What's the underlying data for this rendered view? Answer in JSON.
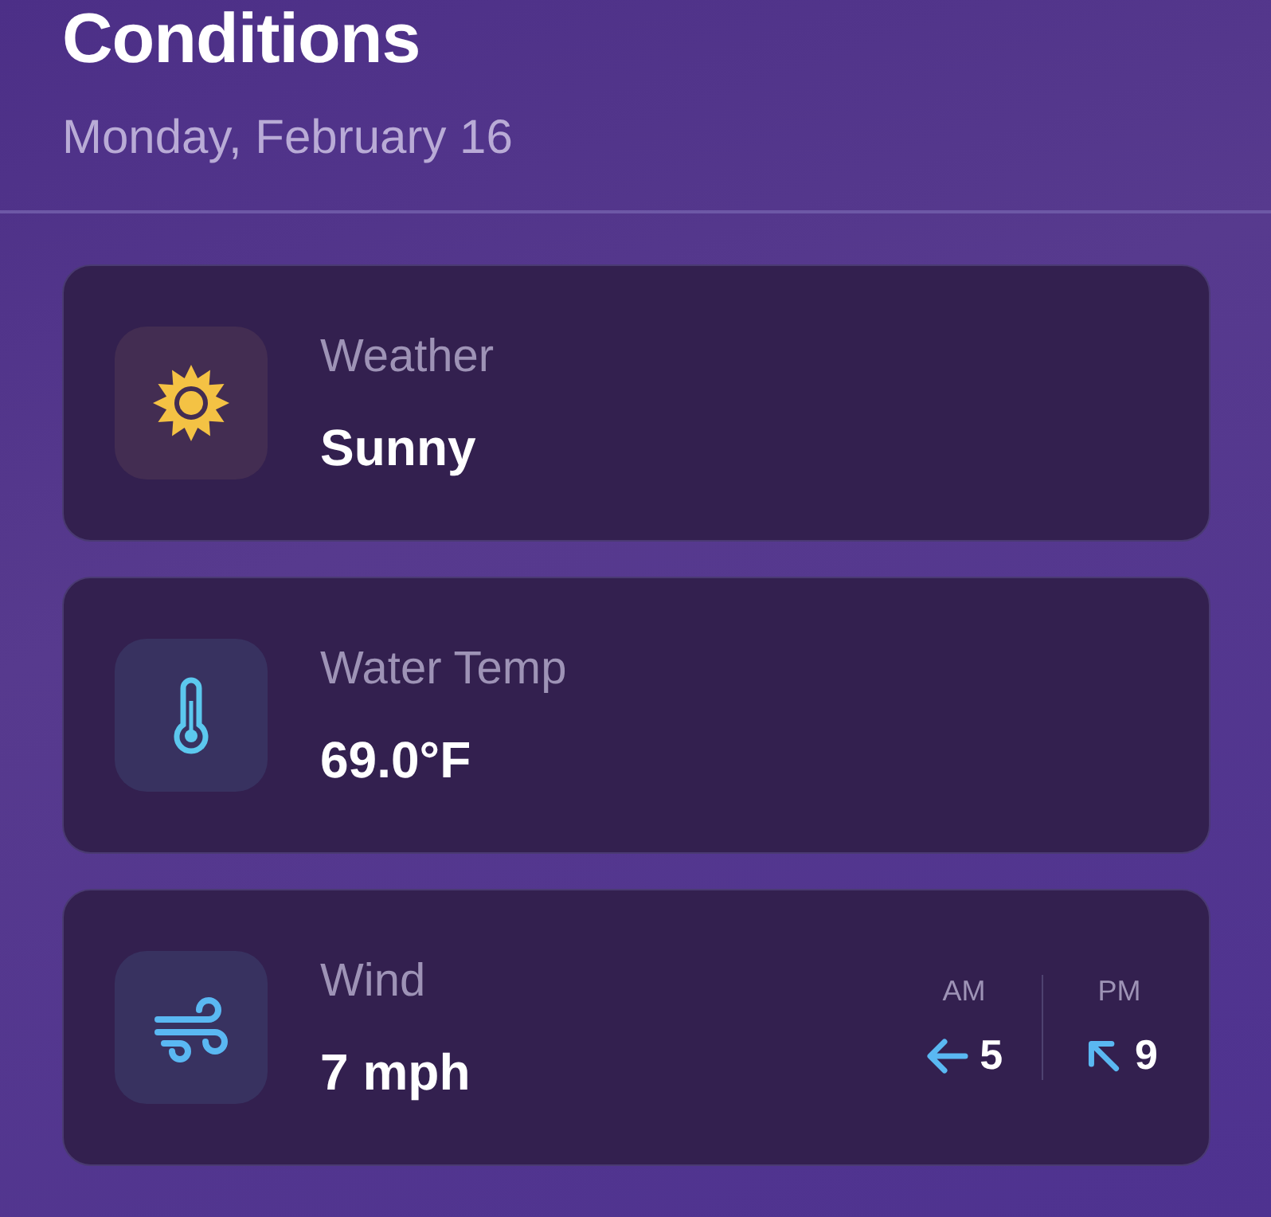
{
  "header": {
    "title": "Conditions",
    "date": "Monday, February 16"
  },
  "cards": [
    {
      "kind": "weather",
      "label": "Weather",
      "value": "Sunny"
    },
    {
      "kind": "temperature",
      "label": "Water Temp",
      "value": "69.0°F"
    },
    {
      "kind": "wind",
      "label": "Wind",
      "value": "7 mph",
      "periods": [
        {
          "label": "AM",
          "kind": "west",
          "speed": "5"
        },
        {
          "label": "PM",
          "kind": "northwest",
          "speed": "9"
        }
      ]
    }
  ]
}
